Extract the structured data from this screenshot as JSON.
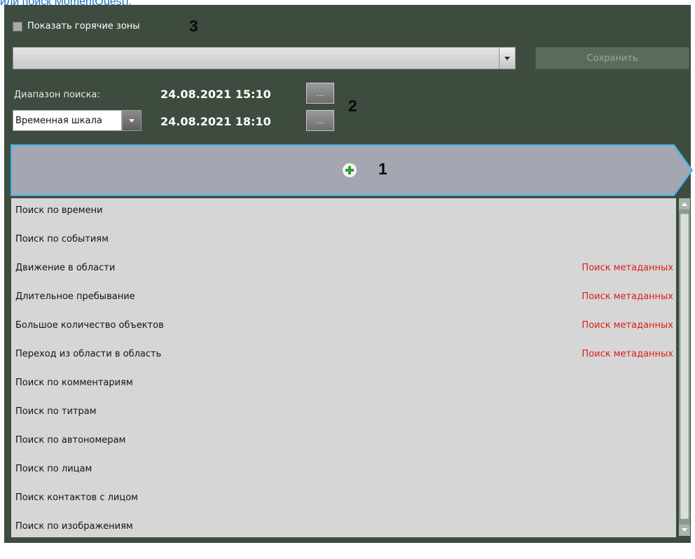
{
  "top_text": "или поиск MomentQuest).",
  "show_hot_zones": {
    "label": "Показать горячие зоны",
    "checked": false
  },
  "annotations": {
    "one": "1",
    "two": "2",
    "three": "3"
  },
  "preset_select": {
    "value": ""
  },
  "save_button": {
    "label": "Сохранить"
  },
  "search_range": {
    "label": "Диапазон поиска:",
    "start": "24.08.2021  15:10",
    "end": "24.08.2021  18:10",
    "picker_label": "..."
  },
  "scale_select": {
    "value": "Временная шкала"
  },
  "add_icon": "plus-icon",
  "search_list": [
    {
      "label": "Поиск по времени",
      "badge": ""
    },
    {
      "label": "Поиск по событиям",
      "badge": ""
    },
    {
      "label": "Движение в области",
      "badge": "Поиск метаданных"
    },
    {
      "label": "Длительное пребывание",
      "badge": "Поиск метаданных"
    },
    {
      "label": "Большое количество объектов",
      "badge": "Поиск метаданных"
    },
    {
      "label": "Переход из области в область",
      "badge": "Поиск метаданных"
    },
    {
      "label": "Поиск по комментариям",
      "badge": ""
    },
    {
      "label": "Поиск по титрам",
      "badge": ""
    },
    {
      "label": "Поиск по автономерам",
      "badge": ""
    },
    {
      "label": "Поиск по лицам",
      "badge": ""
    },
    {
      "label": "Поиск контактов с лицом",
      "badge": ""
    },
    {
      "label": "Поиск по изображениям",
      "badge": ""
    }
  ],
  "colors": {
    "panel": "#3e4c3f",
    "list_bg": "#d6d6d6",
    "header": "#a4a6b2",
    "accent": "#3eb3ea",
    "badge": "#e01a1a"
  }
}
